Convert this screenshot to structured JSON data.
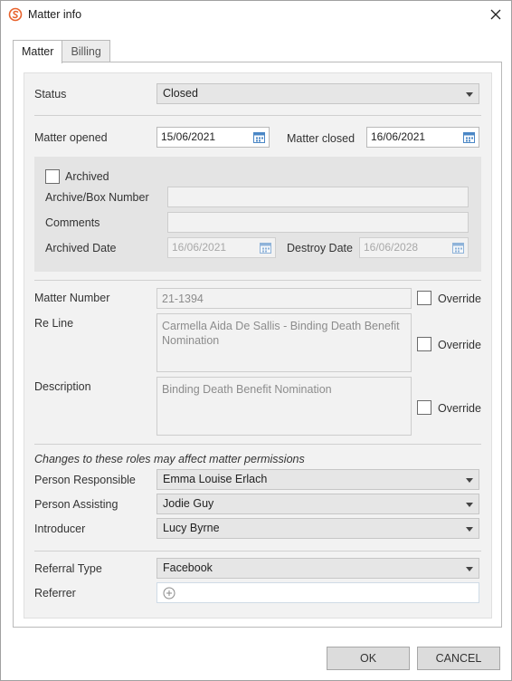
{
  "window": {
    "title": "Matter info"
  },
  "tabs": [
    {
      "label": "Matter"
    },
    {
      "label": "Billing"
    }
  ],
  "status": {
    "label": "Status",
    "value": "Closed"
  },
  "dates": {
    "opened_label": "Matter opened",
    "opened_value": "15/06/2021",
    "closed_label": "Matter closed",
    "closed_value": "16/06/2021"
  },
  "archive": {
    "archived_label": "Archived",
    "box_number_label": "Archive/Box Number",
    "comments_label": "Comments",
    "archived_date_label": "Archived Date",
    "archived_date_value": "16/06/2021",
    "destroy_date_label": "Destroy Date",
    "destroy_date_value": "16/06/2028"
  },
  "matter": {
    "number_label": "Matter Number",
    "number_value": "21-1394",
    "reline_label": "Re Line",
    "reline_value": "Carmella Aida De Sallis - Binding Death Benefit Nomination",
    "description_label": "Description",
    "description_value": "Binding Death Benefit Nomination",
    "override_label": "Override"
  },
  "roles": {
    "note": "Changes to these roles may affect matter permissions",
    "responsible_label": "Person Responsible",
    "responsible_value": "Emma Louise Erlach",
    "assisting_label": "Person Assisting",
    "assisting_value": "Jodie Guy",
    "introducer_label": "Introducer",
    "introducer_value": "Lucy Byrne"
  },
  "referral": {
    "type_label": "Referral Type",
    "type_value": "Facebook",
    "referrer_label": "Referrer"
  },
  "footer": {
    "ok_label": "OK",
    "cancel_label": "CANCEL"
  },
  "colors": {
    "accent": "#e8622c",
    "field_bg": "#e6e6e6",
    "panel_bg": "#f2f2f2"
  }
}
